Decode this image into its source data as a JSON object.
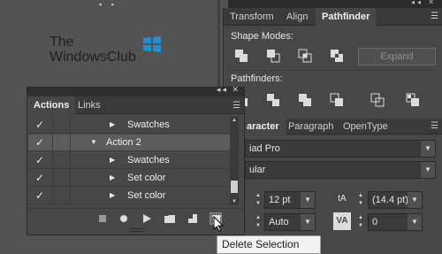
{
  "logo": {
    "line1": "The",
    "line2": "WindowsClub"
  },
  "right_panel": {
    "tabs": [
      "Transform",
      "Align",
      "Pathfinder"
    ],
    "active_tab": "Pathfinder",
    "shape_modes_label": "Shape Modes:",
    "expand_label": "Expand",
    "pathfinders_label": "Pathfinders:"
  },
  "character_panel": {
    "tabs": [
      "aracter",
      "Paragraph",
      "OpenType"
    ],
    "font_family": "iad Pro",
    "font_style": "ular",
    "font_size": "12 pt",
    "leading": "(14.4 pt)",
    "kerning": "Auto",
    "tracking": "0"
  },
  "actions_panel": {
    "tabs": [
      "Actions",
      "Links"
    ],
    "active_tab": "Actions",
    "rows": [
      {
        "label": "Swatches",
        "expanded": false,
        "selected": false
      },
      {
        "label": "Action 2",
        "expanded": true,
        "selected": true
      },
      {
        "label": "Swatches",
        "expanded": false,
        "selected": false
      },
      {
        "label": "Set color",
        "expanded": false,
        "selected": false
      },
      {
        "label": "Set color",
        "expanded": false,
        "selected": false
      }
    ]
  },
  "tooltip": "Delete Selection"
}
